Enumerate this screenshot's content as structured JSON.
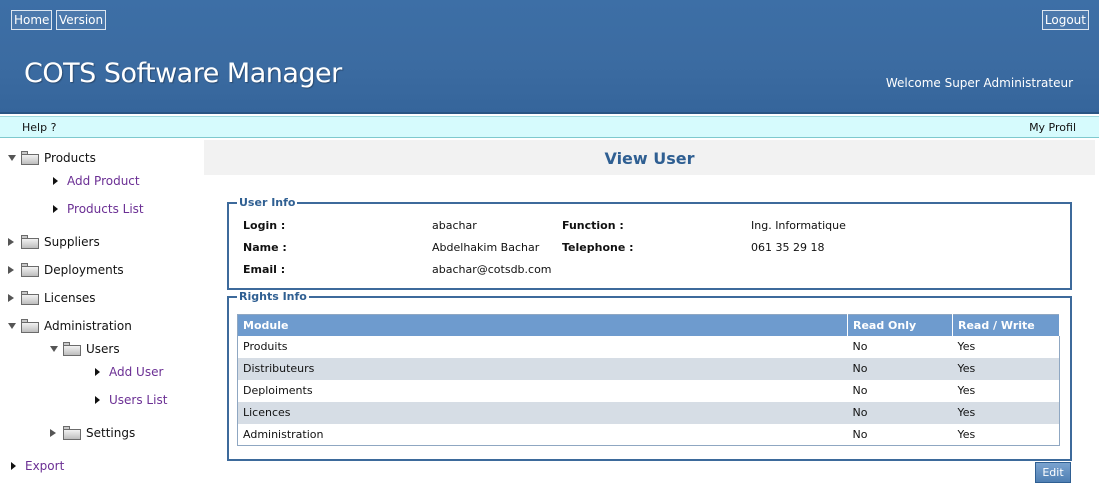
{
  "header": {
    "home_label": "Home",
    "version_label": "Version",
    "logout_label": "Logout",
    "app_title": "COTS Software Manager",
    "welcome_text": "Welcome Super Administrateur"
  },
  "helpbar": {
    "help_label": "Help ?",
    "profile_label": "My Profil"
  },
  "sidebar": {
    "products": "Products",
    "add_product": "Add Product",
    "products_list": "Products List",
    "suppliers": "Suppliers",
    "deployments": "Deployments",
    "licenses": "Licenses",
    "administration": "Administration",
    "users": "Users",
    "add_user": "Add User",
    "users_list": "Users List",
    "settings": "Settings",
    "export": "Export"
  },
  "page": {
    "title": "View User"
  },
  "user_info": {
    "legend": "User Info",
    "login_label": "Login :",
    "login": "abachar",
    "name_label": "Name :",
    "name": "Abdelhakim Bachar",
    "email_label": "Email :",
    "email": "abachar@cotsdb.com",
    "function_label": "Function :",
    "function": "Ing. Informatique",
    "telephone_label": "Telephone :",
    "telephone": "061 35 29 18"
  },
  "rights_info": {
    "legend": "Rights Info",
    "columns": [
      "Module",
      "Read Only",
      "Read / Write"
    ],
    "rows": [
      [
        "Produits",
        "No",
        "Yes"
      ],
      [
        "Distributeurs",
        "No",
        "Yes"
      ],
      [
        "Deploiments",
        "No",
        "Yes"
      ],
      [
        "Licences",
        "No",
        "Yes"
      ],
      [
        "Administration",
        "No",
        "Yes"
      ]
    ]
  },
  "actions": {
    "edit_label": "Edit"
  },
  "colors": {
    "header_blue": "#3b6ba1",
    "helpbar_cyan": "#d6fbfd",
    "title_blue": "#2f5f92",
    "table_header": "#6e9bce",
    "link_purple": "#6b2f94"
  }
}
